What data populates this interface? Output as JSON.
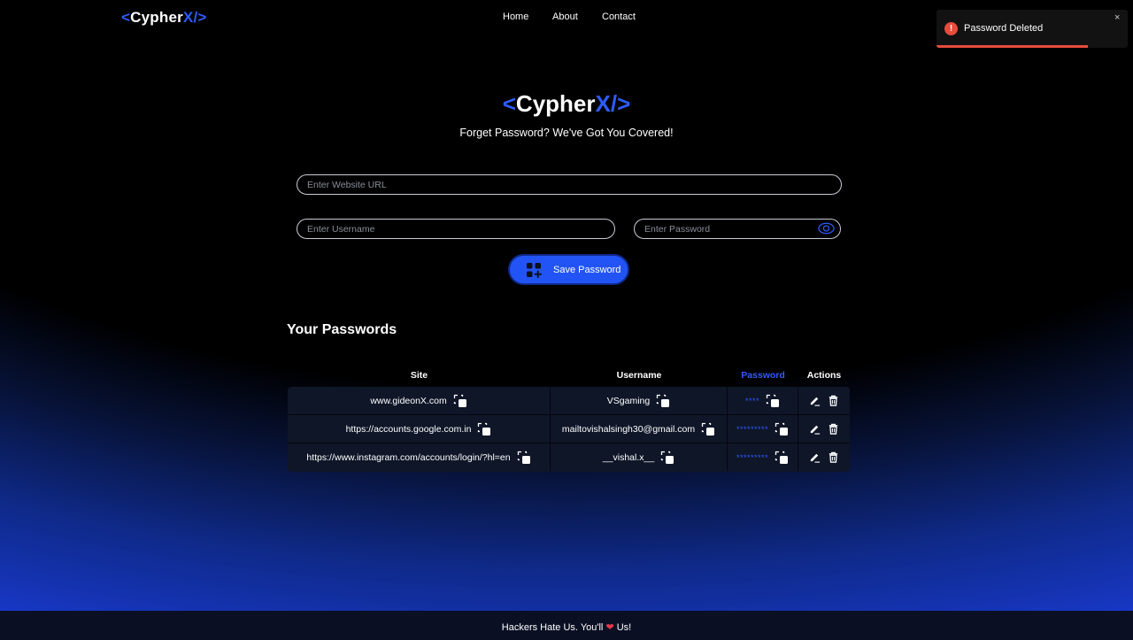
{
  "brand": {
    "open": "<",
    "name": "Cypher",
    "x": "X",
    "close": "/>"
  },
  "nav": {
    "home": "Home",
    "about": "About",
    "contact": "Contact"
  },
  "toast": {
    "message": "Password Deleted",
    "icon": "!",
    "close": "×",
    "progress_fraction": 0.79
  },
  "hero": {
    "tagline": "Forget Password? We've Got You Covered!"
  },
  "form": {
    "url_placeholder": "Enter Website URL",
    "username_placeholder": "Enter Username",
    "password_placeholder": "Enter Password",
    "save_label": "Save Password"
  },
  "passwords": {
    "title": "Your Passwords",
    "headers": {
      "site": "Site",
      "username": "Username",
      "password": "Password",
      "actions": "Actions"
    },
    "rows": [
      {
        "site": "www.gideonX.com",
        "username": "VSgaming",
        "password": "****"
      },
      {
        "site": "https://accounts.google.com.in",
        "username": "mailtovishalsingh30@gmail.com",
        "password": "*********"
      },
      {
        "site": "https://www.instagram.com/accounts/login/?hl=en",
        "username": "__vishal.x__",
        "password": "*********"
      }
    ]
  },
  "footer": {
    "text_before": "Hackers Hate Us. You'll",
    "heart": "❤",
    "text_after": "Us!"
  },
  "colors": {
    "accent": "#2e5bff",
    "button": "#2254f5",
    "danger": "#e74c3c",
    "row_bg": "#0f1628"
  },
  "icons": {
    "copy": "copy-icon",
    "edit": "edit-icon",
    "delete": "trash-icon",
    "eye": "eye-icon",
    "save": "add-grid-icon",
    "alert": "alert-icon"
  }
}
